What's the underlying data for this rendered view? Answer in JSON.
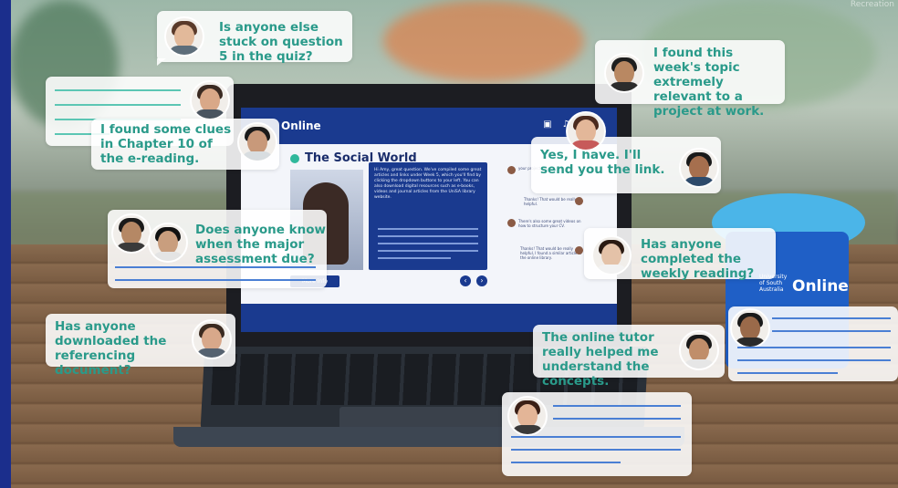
{
  "colors": {
    "brand_blue": "#1a3a8f",
    "bubble_text_teal": "#2a9a8a",
    "bubble_line_blue": "#4a7fd4",
    "cup_blue": "#1f5fc6",
    "lid_cyan": "#4bb5e8"
  },
  "watermark": "Recreation",
  "laptop_screen": {
    "brand": "Online",
    "toolbar_icons": "▣ ♫ ? ▦",
    "course_title": "The Social World",
    "panel_text": "Hi Amy, great question. We've compiled some great articles and links under Week 5, which you'll find by clicking the dropdown buttons to your left. You can also download digital resources such as e-books, videos and journal articles from the UniSA library website.",
    "more_info_label": "More info",
    "prev_label": "‹",
    "next_label": "›",
    "mini_chat": [
      "your project or you",
      "Thanks! That would be really helpful.",
      "There's also some great videos on how to structure your CV.",
      "Thanks! That would be really helpful, I found a similar article in the online library."
    ]
  },
  "cup": {
    "small_text": "University of South Australia",
    "brand": "Online"
  },
  "bubbles": [
    {
      "id": "q5",
      "text": "Is anyone else stuck on question 5 in the quiz?"
    },
    {
      "id": "topic",
      "text": "I found this week's topic extremely relevant to a project at work."
    },
    {
      "id": "clues",
      "text": "I found some clues in Chapter 10 of the e-reading."
    },
    {
      "id": "send",
      "text": "Yes, I have. I'll send you the link."
    },
    {
      "id": "assessment",
      "text": "Does anyone know when the major assessment due?"
    },
    {
      "id": "weekly",
      "text": "Has anyone completed the weekly reading?"
    },
    {
      "id": "referencing",
      "text": "Has anyone downloaded the referencing document?"
    },
    {
      "id": "tutor",
      "text": "The online tutor really helped me understand the concepts."
    }
  ]
}
